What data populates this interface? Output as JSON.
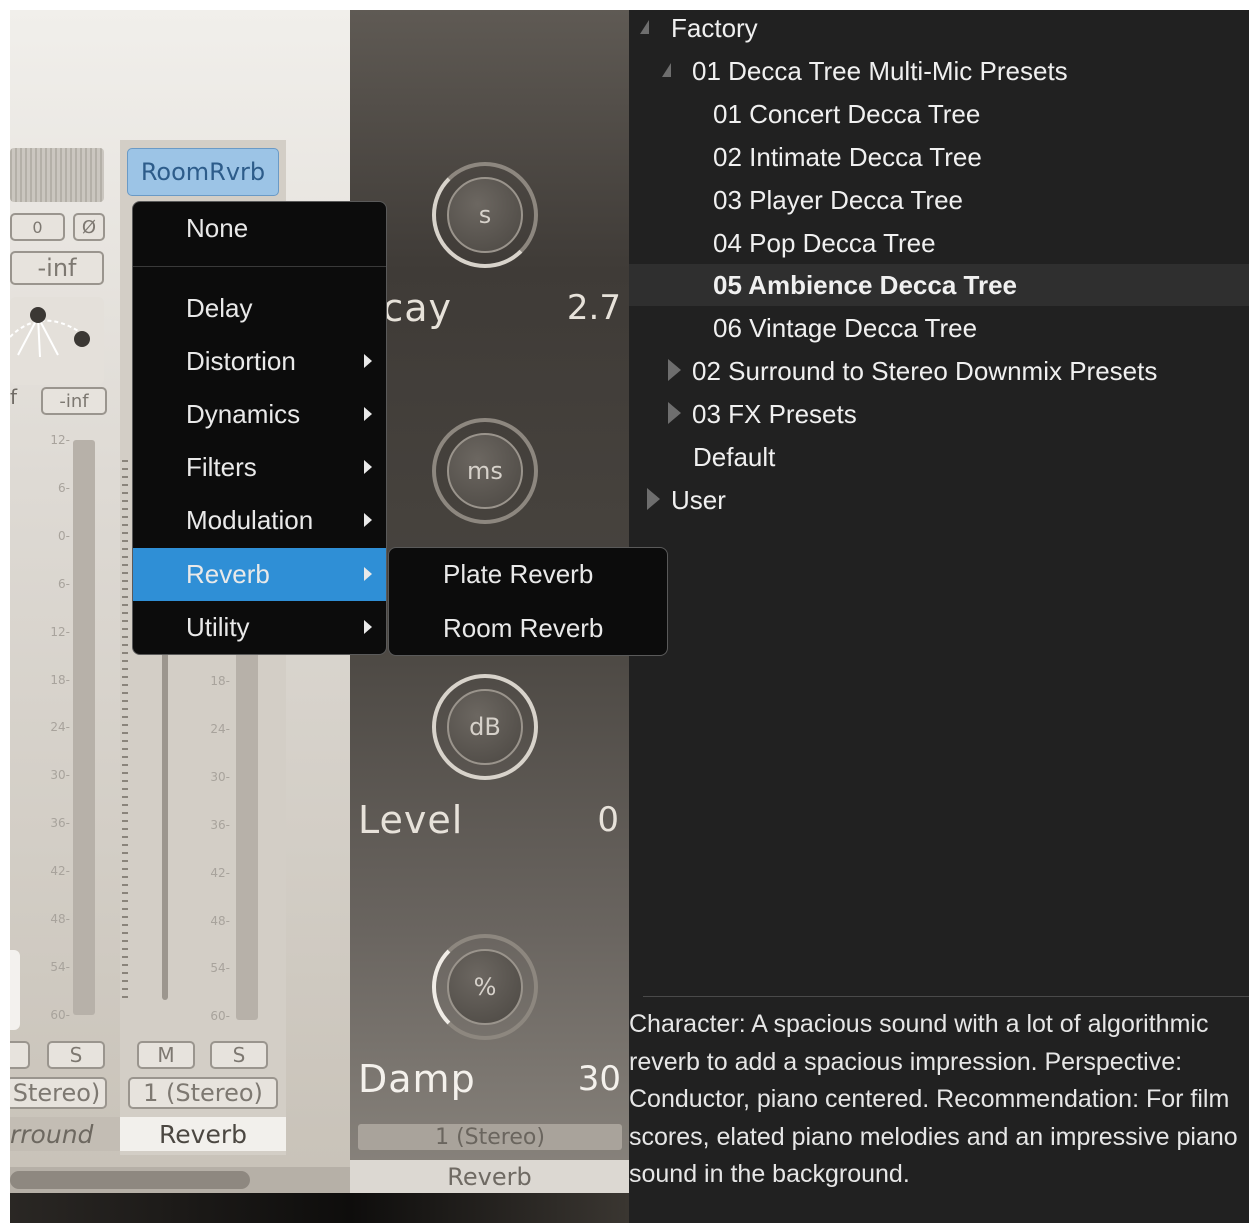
{
  "mixer": {
    "room_button": "RoomRvrb",
    "value_zero": "0",
    "phase_symbol": "Ø",
    "inf_left": "-inf",
    "f_left": "f",
    "inf_small": "-inf",
    "ticks": [
      "12",
      "6",
      "0",
      "6",
      "12",
      "18",
      "24",
      "30",
      "36",
      "42",
      "48",
      "54",
      "60"
    ],
    "ticks_right": [
      "18",
      "24",
      "30",
      "36",
      "42",
      "48",
      "54",
      "60"
    ],
    "solo_left": "S",
    "mute": "M",
    "solo": "S",
    "stereo_left": "Stereo)",
    "stereo_right": "1 (Stereo)",
    "name_left": "rround",
    "name_right": "Reverb"
  },
  "reverb": {
    "decay_unit": "s",
    "decay_label": "ecay",
    "decay_value": "2.7",
    "predelay_unit": "ms",
    "level_unit": "dB",
    "level_label": "Level",
    "level_value": "0",
    "damp_unit": "%",
    "damp_label": "Damp",
    "damp_value": "30",
    "stereo": "1 (Stereo)",
    "name": "Reverb"
  },
  "menu": {
    "none": "None",
    "items": [
      "Delay",
      "Distortion",
      "Dynamics",
      "Filters",
      "Modulation",
      "Reverb",
      "Utility"
    ],
    "submenu": [
      "Plate Reverb",
      "Room Reverb"
    ]
  },
  "browser": {
    "factory": "Factory",
    "group1": "01 Decca Tree Multi-Mic Presets",
    "presets": [
      "01 Concert Decca Tree",
      "02 Intimate Decca Tree",
      "03 Player Decca Tree",
      "04 Pop Decca Tree",
      "05 Ambience Decca Tree",
      "06 Vintage Decca Tree"
    ],
    "group2": "02 Surround to Stereo Downmix Presets",
    "group3": "03 FX Presets",
    "default": "Default",
    "user": "User",
    "description": "Character: A spacious sound with a lot of algorithmic reverb to add a spacious impression. Perspective: Conductor, piano centered. Recommendation: For film scores, elated piano melodies and an impressive piano sound in the background."
  }
}
